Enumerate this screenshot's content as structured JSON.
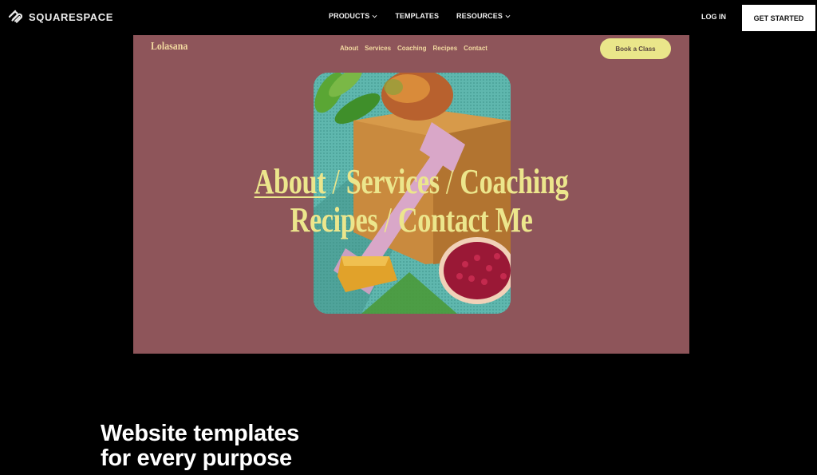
{
  "header": {
    "brand": "SQUARESPACE",
    "nav": [
      {
        "label": "PRODUCTS",
        "has_dropdown": true
      },
      {
        "label": "TEMPLATES",
        "has_dropdown": false
      },
      {
        "label": "RESOURCES",
        "has_dropdown": true
      }
    ],
    "login_label": "LOG IN",
    "cta_label": "GET STARTED"
  },
  "preview": {
    "brand": "Lolasana",
    "nav": [
      "About",
      "Services",
      "Coaching",
      "Recipes",
      "Contact"
    ],
    "book_label": "Book a Class",
    "headline": {
      "line1": [
        "About",
        "Services",
        "Coaching"
      ],
      "line2": [
        "Recipes",
        "Contact Me"
      ],
      "separator": "/",
      "active": "About"
    },
    "colors": {
      "background": "#8e555a",
      "accent": "#ece68c",
      "nav_text": "#f2d9a0",
      "button": "#eae68a"
    },
    "photo": "still life with pink dumbbell, cork yoga block, mango, honeycomb and pomegranate on teal mat"
  },
  "section": {
    "title_line1": "Website templates",
    "title_line2": "for every purpose"
  }
}
